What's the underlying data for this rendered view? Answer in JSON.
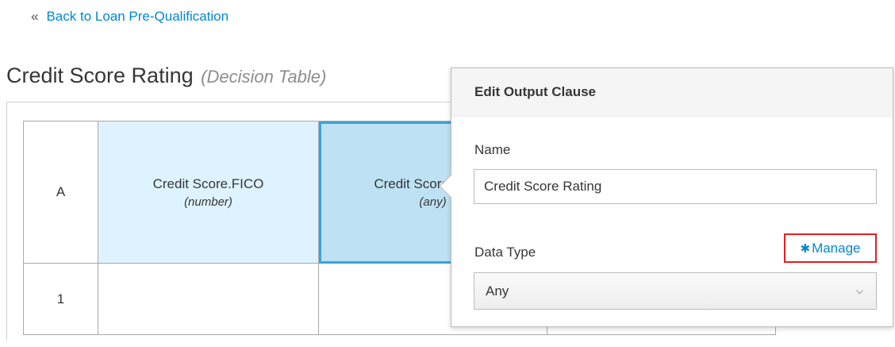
{
  "nav": {
    "back_chevron": "«",
    "back_label": "Back to Loan Pre-Qualification"
  },
  "page": {
    "title": "Credit Score Rating",
    "subtitle": "(Decision Table)"
  },
  "decision_table": {
    "hit_policy": "A",
    "input_column": {
      "name": "Credit Score.FICO",
      "type": "(number)"
    },
    "output_column": {
      "name": "Credit Score Rating",
      "type": "(any)"
    },
    "rows": [
      {
        "number": "1"
      }
    ]
  },
  "popover": {
    "title": "Edit Output Clause",
    "name_label": "Name",
    "name_value": "Credit Score Rating",
    "data_type_label": "Data Type",
    "manage_icon": "gear-icon",
    "manage_label": "Manage",
    "data_type_value": "Any"
  },
  "colors": {
    "link": "#0088ce",
    "input_header_bg": "#def3ff",
    "output_header_bg": "#bee1f4",
    "selection_border": "#39a5dc",
    "highlight_box": "#e02020"
  }
}
